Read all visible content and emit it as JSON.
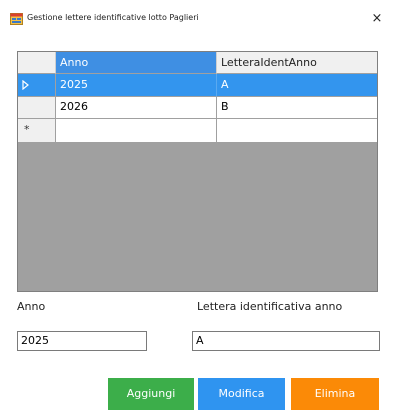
{
  "window": {
    "title": "Gestione lettere identificative lotto Paglieri",
    "close_glyph": "×",
    "icon": "form-icon"
  },
  "grid": {
    "columns": [
      "Anno",
      "LetteraIdentAnno"
    ],
    "rows": [
      {
        "anno": "2025",
        "lettera": "A",
        "selected": true
      },
      {
        "anno": "2026",
        "lettera": "B",
        "selected": false
      }
    ],
    "new_row_marker": "*",
    "current_row_icon": "current-row-arrow-icon"
  },
  "form": {
    "anno_label": "Anno",
    "lettera_label": "Lettera identificativa anno",
    "anno_value": "2025",
    "lettera_value": "A"
  },
  "buttons": {
    "aggiungi": "Aggiungi",
    "modifica": "Modifica",
    "elimina": "Elimina"
  },
  "colors": {
    "aggiungi": "#3cae4a",
    "modifica": "#2f94f0",
    "elimina": "#fb8a07",
    "selection": "#3395ee",
    "grid_background": "#a0a0a0"
  }
}
